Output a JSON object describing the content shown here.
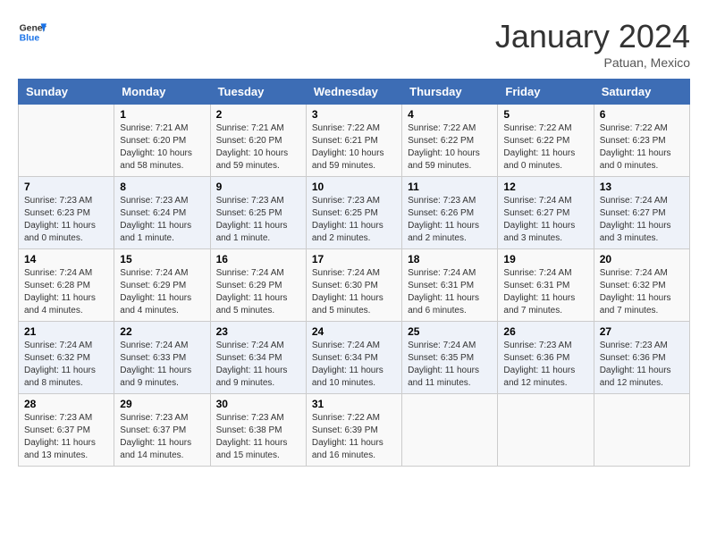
{
  "header": {
    "logo_general": "General",
    "logo_blue": "Blue",
    "month_title": "January 2024",
    "subtitle": "Patuan, Mexico"
  },
  "columns": [
    "Sunday",
    "Monday",
    "Tuesday",
    "Wednesday",
    "Thursday",
    "Friday",
    "Saturday"
  ],
  "weeks": [
    [
      {
        "day": "",
        "info": ""
      },
      {
        "day": "1",
        "info": "Sunrise: 7:21 AM\nSunset: 6:20 PM\nDaylight: 10 hours\nand 58 minutes."
      },
      {
        "day": "2",
        "info": "Sunrise: 7:21 AM\nSunset: 6:20 PM\nDaylight: 10 hours\nand 59 minutes."
      },
      {
        "day": "3",
        "info": "Sunrise: 7:22 AM\nSunset: 6:21 PM\nDaylight: 10 hours\nand 59 minutes."
      },
      {
        "day": "4",
        "info": "Sunrise: 7:22 AM\nSunset: 6:22 PM\nDaylight: 10 hours\nand 59 minutes."
      },
      {
        "day": "5",
        "info": "Sunrise: 7:22 AM\nSunset: 6:22 PM\nDaylight: 11 hours\nand 0 minutes."
      },
      {
        "day": "6",
        "info": "Sunrise: 7:22 AM\nSunset: 6:23 PM\nDaylight: 11 hours\nand 0 minutes."
      }
    ],
    [
      {
        "day": "7",
        "info": "Sunrise: 7:23 AM\nSunset: 6:23 PM\nDaylight: 11 hours\nand 0 minutes."
      },
      {
        "day": "8",
        "info": "Sunrise: 7:23 AM\nSunset: 6:24 PM\nDaylight: 11 hours\nand 1 minute."
      },
      {
        "day": "9",
        "info": "Sunrise: 7:23 AM\nSunset: 6:25 PM\nDaylight: 11 hours\nand 1 minute."
      },
      {
        "day": "10",
        "info": "Sunrise: 7:23 AM\nSunset: 6:25 PM\nDaylight: 11 hours\nand 2 minutes."
      },
      {
        "day": "11",
        "info": "Sunrise: 7:23 AM\nSunset: 6:26 PM\nDaylight: 11 hours\nand 2 minutes."
      },
      {
        "day": "12",
        "info": "Sunrise: 7:24 AM\nSunset: 6:27 PM\nDaylight: 11 hours\nand 3 minutes."
      },
      {
        "day": "13",
        "info": "Sunrise: 7:24 AM\nSunset: 6:27 PM\nDaylight: 11 hours\nand 3 minutes."
      }
    ],
    [
      {
        "day": "14",
        "info": "Sunrise: 7:24 AM\nSunset: 6:28 PM\nDaylight: 11 hours\nand 4 minutes."
      },
      {
        "day": "15",
        "info": "Sunrise: 7:24 AM\nSunset: 6:29 PM\nDaylight: 11 hours\nand 4 minutes."
      },
      {
        "day": "16",
        "info": "Sunrise: 7:24 AM\nSunset: 6:29 PM\nDaylight: 11 hours\nand 5 minutes."
      },
      {
        "day": "17",
        "info": "Sunrise: 7:24 AM\nSunset: 6:30 PM\nDaylight: 11 hours\nand 5 minutes."
      },
      {
        "day": "18",
        "info": "Sunrise: 7:24 AM\nSunset: 6:31 PM\nDaylight: 11 hours\nand 6 minutes."
      },
      {
        "day": "19",
        "info": "Sunrise: 7:24 AM\nSunset: 6:31 PM\nDaylight: 11 hours\nand 7 minutes."
      },
      {
        "day": "20",
        "info": "Sunrise: 7:24 AM\nSunset: 6:32 PM\nDaylight: 11 hours\nand 7 minutes."
      }
    ],
    [
      {
        "day": "21",
        "info": "Sunrise: 7:24 AM\nSunset: 6:32 PM\nDaylight: 11 hours\nand 8 minutes."
      },
      {
        "day": "22",
        "info": "Sunrise: 7:24 AM\nSunset: 6:33 PM\nDaylight: 11 hours\nand 9 minutes."
      },
      {
        "day": "23",
        "info": "Sunrise: 7:24 AM\nSunset: 6:34 PM\nDaylight: 11 hours\nand 9 minutes."
      },
      {
        "day": "24",
        "info": "Sunrise: 7:24 AM\nSunset: 6:34 PM\nDaylight: 11 hours\nand 10 minutes."
      },
      {
        "day": "25",
        "info": "Sunrise: 7:24 AM\nSunset: 6:35 PM\nDaylight: 11 hours\nand 11 minutes."
      },
      {
        "day": "26",
        "info": "Sunrise: 7:23 AM\nSunset: 6:36 PM\nDaylight: 11 hours\nand 12 minutes."
      },
      {
        "day": "27",
        "info": "Sunrise: 7:23 AM\nSunset: 6:36 PM\nDaylight: 11 hours\nand 12 minutes."
      }
    ],
    [
      {
        "day": "28",
        "info": "Sunrise: 7:23 AM\nSunset: 6:37 PM\nDaylight: 11 hours\nand 13 minutes."
      },
      {
        "day": "29",
        "info": "Sunrise: 7:23 AM\nSunset: 6:37 PM\nDaylight: 11 hours\nand 14 minutes."
      },
      {
        "day": "30",
        "info": "Sunrise: 7:23 AM\nSunset: 6:38 PM\nDaylight: 11 hours\nand 15 minutes."
      },
      {
        "day": "31",
        "info": "Sunrise: 7:22 AM\nSunset: 6:39 PM\nDaylight: 11 hours\nand 16 minutes."
      },
      {
        "day": "",
        "info": ""
      },
      {
        "day": "",
        "info": ""
      },
      {
        "day": "",
        "info": ""
      }
    ]
  ]
}
